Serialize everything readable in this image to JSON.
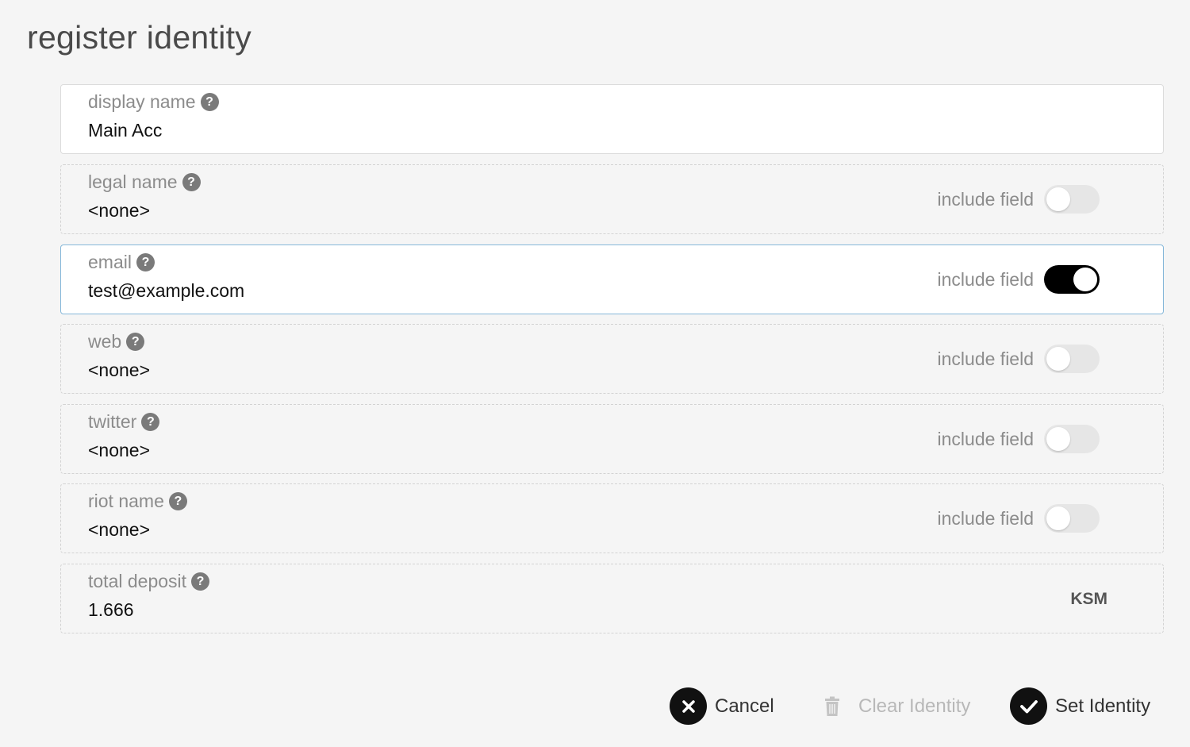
{
  "title": "register identity",
  "fields": [
    {
      "label": "display name",
      "value": "Main Acc",
      "include_label": "",
      "include": null
    },
    {
      "label": "legal name",
      "value": "<none>",
      "include_label": "include field",
      "include": false
    },
    {
      "label": "email",
      "value": "test@example.com",
      "include_label": "include field",
      "include": true
    },
    {
      "label": "web",
      "value": "<none>",
      "include_label": "include field",
      "include": false
    },
    {
      "label": "twitter",
      "value": "<none>",
      "include_label": "include field",
      "include": false
    },
    {
      "label": "riot name",
      "value": "<none>",
      "include_label": "include field",
      "include": false
    }
  ],
  "deposit": {
    "label": "total deposit",
    "value": "1.666",
    "unit": "KSM"
  },
  "actions": {
    "cancel_label": "Cancel",
    "clear_label": "Clear Identity",
    "set_label": "Set Identity"
  },
  "icons": {
    "help": "question-circle-icon",
    "cancel": "close-icon",
    "clear": "trash-icon",
    "set": "checkmark-icon"
  },
  "colors": {
    "focus_border": "#85b7d9",
    "toggle_on": "#000000",
    "toggle_off": "#e6e6e6"
  }
}
